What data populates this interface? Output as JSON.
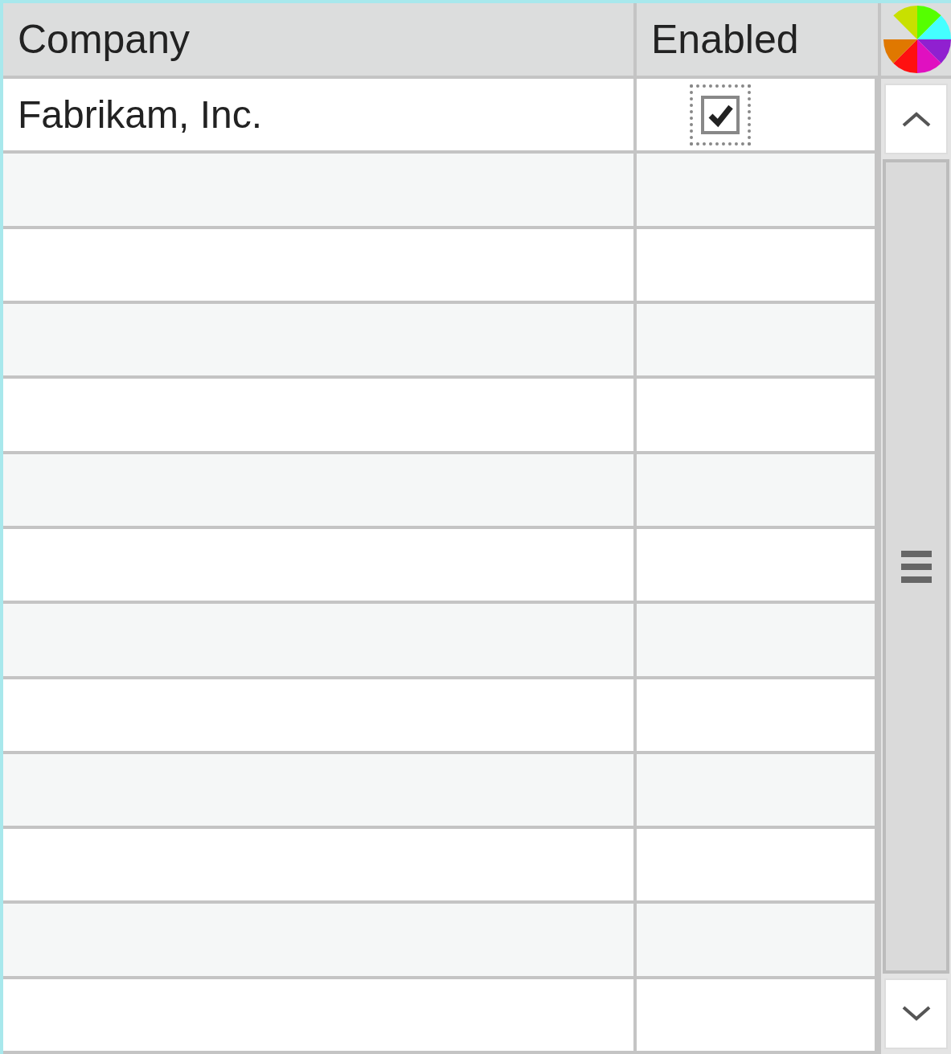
{
  "columns": [
    {
      "label": "Company"
    },
    {
      "label": "Enabled"
    }
  ],
  "rows": [
    {
      "company": "Fabrikam, Inc.",
      "enabled": true
    }
  ]
}
